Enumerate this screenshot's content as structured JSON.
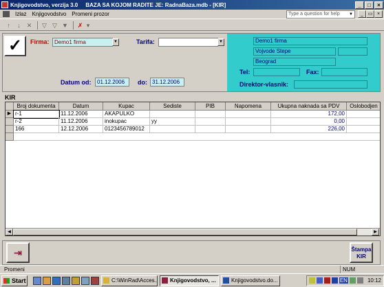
{
  "window": {
    "app_title": "Knjigovodstvo, verzija 3.0",
    "db_title": "BAZA SA KOJOM RADITE JE: RadnaBaza.mdb - [KIR]",
    "min": "_",
    "max": "□",
    "close": "×"
  },
  "menu": {
    "items": [
      {
        "label": "Izlaz"
      },
      {
        "label": "Knjigovodstvo"
      },
      {
        "label": "Promeni prozor"
      }
    ],
    "help_placeholder": "Type a question for help"
  },
  "form": {
    "firma_label": "Firma:",
    "firma_value": "Demo1 firma",
    "tarifa_label": "Tarifa:",
    "tarifa_value": "",
    "datum_od_label": "Datum od:",
    "datum_od_value": "01.12.2006",
    "do_label": "do:",
    "do_value": "31.12.2006"
  },
  "company": {
    "name": "Demo1 firma",
    "address": "Vojvode Stepe",
    "city": "Beograd",
    "tel_label": "Tel:",
    "tel_value": "",
    "fax_label": "Fax:",
    "fax_value": "",
    "director_label": "Direktor-vlasnik:",
    "director_value": ""
  },
  "grid": {
    "section_label": "KIR",
    "columns": [
      "Broj dokumenta",
      "Datum",
      "Kupac",
      "Sediste",
      "PIB",
      "Napomena",
      "Ukupna naknada sa PDV",
      "Oslobodjen"
    ],
    "rows": [
      {
        "broj": "r-1",
        "datum": "11.12.2006",
        "kupac": "AKAPULKO",
        "sediste": "",
        "pib": "",
        "napomena": "",
        "ukupno": "172,00"
      },
      {
        "broj": "r-2",
        "datum": "11.12.2006",
        "kupac": "inokupac",
        "sediste": "yy",
        "pib": "",
        "napomena": "",
        "ukupno": "0,00"
      },
      {
        "broj": "166",
        "datum": "12.12.2006",
        "kupac": "0123456789012",
        "sediste": "",
        "pib": "",
        "napomena": "",
        "ukupno": "226,00"
      }
    ]
  },
  "buttons": {
    "exit_label": "",
    "print_label": "Štampa KIR"
  },
  "status": {
    "left": "Promeni",
    "num": "NUM"
  },
  "taskbar": {
    "start": "Start",
    "tasks": [
      {
        "label": "C:\\WinRad\\Acces..."
      },
      {
        "label": "Knjigovodstvo, ..."
      },
      {
        "label": "Knjigovodstvo.do..."
      }
    ],
    "lang": "EN",
    "time": "10:12"
  }
}
